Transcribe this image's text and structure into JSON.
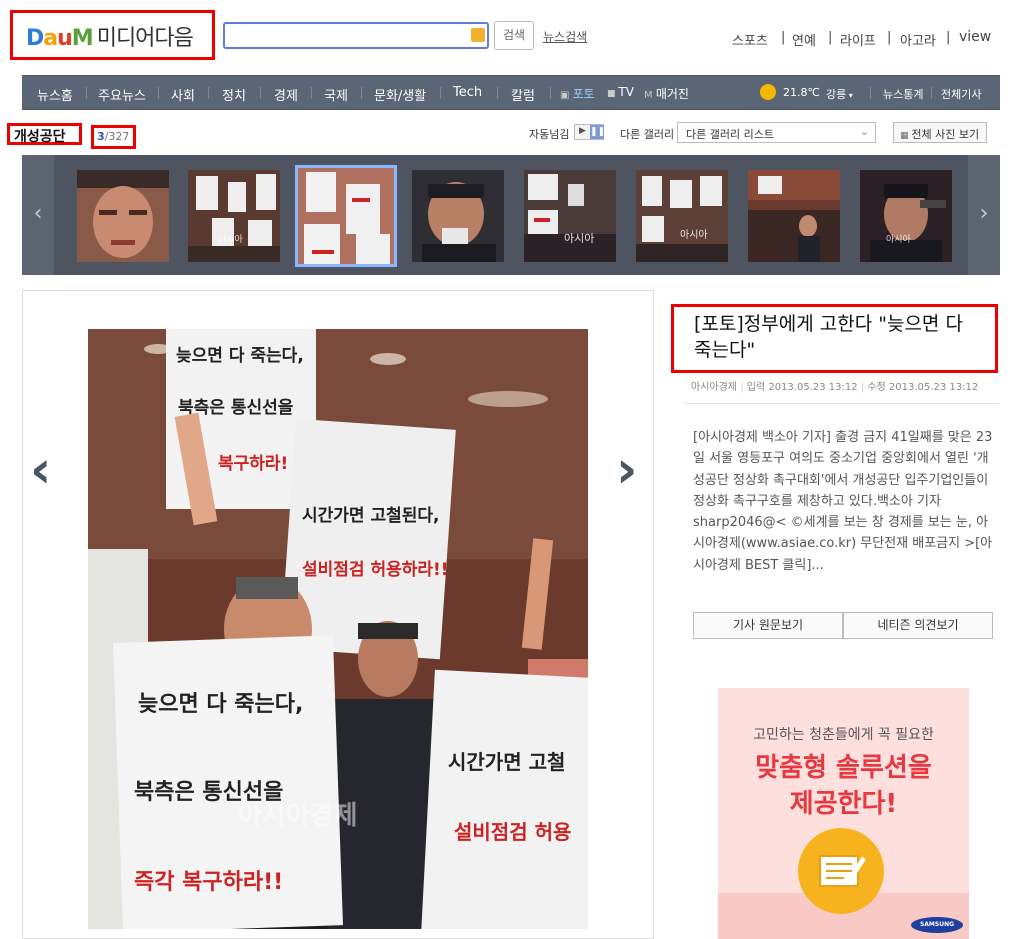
{
  "header": {
    "logo": {
      "d": "D",
      "a": "a",
      "u": "u",
      "m": "M",
      "service": "미디어다음"
    },
    "search_button": "검색",
    "news_search": "뉴스검색",
    "top_links": [
      "스포츠",
      "연예",
      "라이프",
      "아고라",
      "view"
    ]
  },
  "gnb": {
    "items": [
      "뉴스홈",
      "주요뉴스",
      "사회",
      "정치",
      "경제",
      "국제",
      "문화/생활",
      "Tech",
      "칼럼"
    ],
    "media": [
      "포토",
      "TV",
      "매거진"
    ],
    "weather_temp": "21.8℃",
    "weather_city": "강릉",
    "right_links": [
      "뉴스통계",
      "전체기사"
    ]
  },
  "gallery": {
    "title": "개성공단",
    "current": "3",
    "total": "/327",
    "auto_label": "자동넘김",
    "other_label": "다른 갤러리",
    "select_value": "다른 갤러리 리스트",
    "all_photos": "전체 사진 보기"
  },
  "thumbnails": [
    {
      "name": "thumb-1",
      "wm": ""
    },
    {
      "name": "thumb-2",
      "wm": "아시아"
    },
    {
      "name": "thumb-3",
      "wm": ""
    },
    {
      "name": "thumb-4",
      "wm": ""
    },
    {
      "name": "thumb-5",
      "wm": "아시아"
    },
    {
      "name": "thumb-6",
      "wm": "아시아"
    },
    {
      "name": "thumb-7",
      "wm": ""
    },
    {
      "name": "thumb-8",
      "wm": "아시아"
    }
  ],
  "photo": {
    "sign1": [
      "늦으면 다 죽는다,",
      "북측은 통신선을",
      "복구하라!"
    ],
    "sign2": [
      "시간가면 고철된다,",
      "설비점검 허용하라!!"
    ],
    "sign3": [
      "늦으면 다 죽는다,",
      "북측은 통신선을",
      "즉각 복구하라!!"
    ],
    "sign4": [
      "시간가면 고철",
      "설비점검 허용"
    ],
    "watermark": "아시아경제"
  },
  "article": {
    "title": "[포토]정부에게 고한다 \"늦으면 다 죽는다\"",
    "source": "아시아경제",
    "input_date": "입력 2013.05.23 13:12",
    "edit_date": "수정 2013.05.23 13:12",
    "body": "[아시아경제 백소아 기자] 출경 금지 41일째를 맞은 23일 서울 영등포구 여의도 중소기업 중앙회에서 열린 '개성공단 정상화 촉구대회'에서 개성공단 입주기업인들이 정상화 촉구구호를 제창하고 있다.백소아 기자 sharp2046@< ©세계를 보는 창 경제를 보는 눈, 아시아경제(www.asiae.co.kr) 무단전재 배포금지 >[아시아경제 BEST 클릭]...",
    "btn_original": "기사 원문보기",
    "btn_comments": "네티즌 의견보기"
  },
  "ad": {
    "sub": "고민하는 청춘들에게 꼭 필요한",
    "main1": "맞춤형 솔루션을",
    "main2": "제공한다!",
    "brand": "SAMSUNG"
  }
}
